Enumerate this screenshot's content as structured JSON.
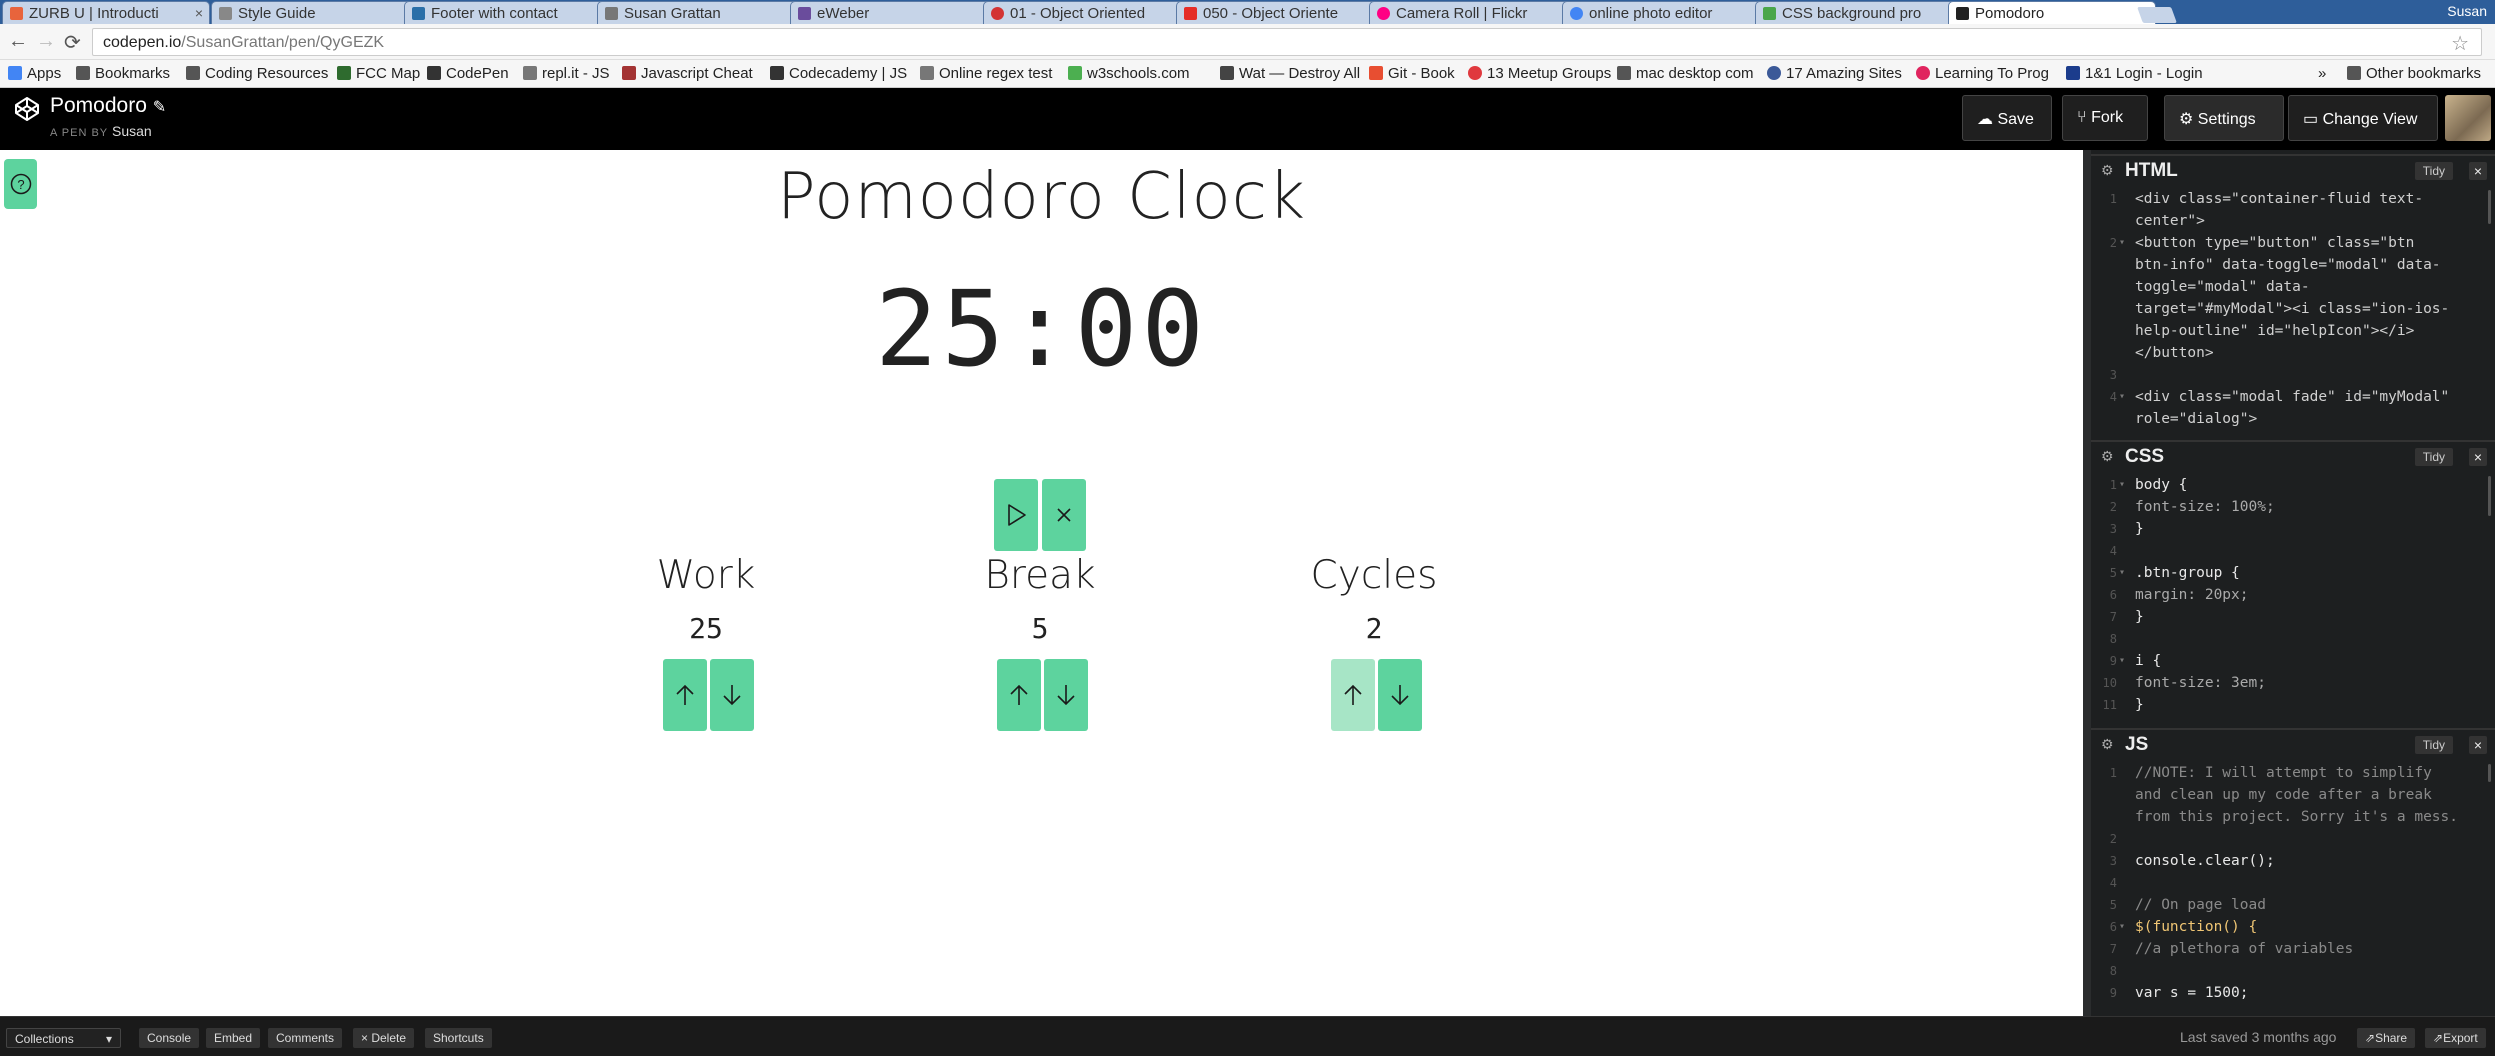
{
  "browser": {
    "tabs": [
      {
        "label": "ZURB U | Introducti",
        "color": "#e8643c"
      },
      {
        "label": "Style Guide",
        "color": "#888888"
      },
      {
        "label": "Footer with contact",
        "color": "#2a6fa8"
      },
      {
        "label": "Susan Grattan",
        "color": "#777777"
      },
      {
        "label": "eWeber",
        "color": "#6a4c9c"
      },
      {
        "label": "01 - Object Oriented",
        "color": "#d33333"
      },
      {
        "label": "050 - Object Oriente",
        "color": "#e52d27"
      },
      {
        "label": "Camera Roll | Flickr",
        "color": "#ff0084"
      },
      {
        "label": "online photo editor",
        "color": "#4285f4"
      },
      {
        "label": "CSS background pro",
        "color": "#4aa64a"
      },
      {
        "label": "Pomodoro",
        "color": "#222222"
      }
    ],
    "tab_close": "×",
    "profile_name": "Susan",
    "address": {
      "host": "codepen.io",
      "path": "/SusanGrattan/pen/QyGEZK"
    },
    "nav": {
      "back": "←",
      "forward": "→",
      "reload": "⟳",
      "star": "☆"
    },
    "bookmarks": [
      {
        "label": "Apps",
        "color": "#4285f4"
      },
      {
        "label": "Bookmarks",
        "color": "#555555"
      },
      {
        "label": "Coding Resources",
        "color": "#555555"
      },
      {
        "label": "FCC Map",
        "color": "#2e6b2e"
      },
      {
        "label": "CodePen",
        "color": "#333333"
      },
      {
        "label": "repl.it - JS",
        "color": "#777777"
      },
      {
        "label": "Javascript Cheat",
        "color": "#a33333"
      },
      {
        "label": "Codecademy | JS",
        "color": "#333333"
      },
      {
        "label": "Online regex test",
        "color": "#777777"
      },
      {
        "label": "w3schools.com",
        "color": "#4caf50"
      },
      {
        "label": "Wat — Destroy All",
        "color": "#444444"
      },
      {
        "label": "Git - Book",
        "color": "#e84e31"
      },
      {
        "label": "13 Meetup Groups",
        "color": "#e0393e"
      },
      {
        "label": "mac desktop com",
        "color": "#555555"
      },
      {
        "label": "17 Amazing Sites",
        "color": "#3b5998"
      },
      {
        "label": "Learning To Prog",
        "color": "#e0245e"
      },
      {
        "label": "1&1 Login - Login",
        "color": "#1b3c8c"
      }
    ],
    "bookmarks_more": "»",
    "other_bookmarks": "Other bookmarks"
  },
  "codepen": {
    "pen_title": "Pomodoro",
    "pen_by_prefix": "A PEN BY",
    "author": "Susan",
    "buttons": {
      "save": "Save",
      "fork": "Fork",
      "settings": "Settings",
      "change_view": "Change View"
    },
    "panels": {
      "html": {
        "name": "HTML",
        "tidy": "Tidy",
        "close": "×",
        "lines": [
          {
            "n": "1",
            "fold": "",
            "text": "<div class=\"container-fluid text-"
          },
          {
            "n": "",
            "fold": "",
            "text": "center\">"
          },
          {
            "n": "2",
            "fold": "▾",
            "text": " <button type=\"button\" class=\"btn"
          },
          {
            "n": "",
            "fold": "",
            "text": " btn-info\" data-toggle=\"modal\" data-"
          },
          {
            "n": "",
            "fold": "",
            "text": " toggle=\"modal\" data-"
          },
          {
            "n": "",
            "fold": "",
            "text": " target=\"#myModal\"><i class=\"ion-ios-"
          },
          {
            "n": "",
            "fold": "",
            "text": " help-outline\" id=\"helpIcon\"></i>"
          },
          {
            "n": "",
            "fold": "",
            "text": " </button>"
          },
          {
            "n": "3",
            "fold": "",
            "text": ""
          },
          {
            "n": "4",
            "fold": "▾",
            "text": " <div class=\"modal fade\" id=\"myModal\""
          },
          {
            "n": "",
            "fold": "",
            "text": " role=\"dialog\">"
          }
        ]
      },
      "css": {
        "name": "CSS",
        "tidy": "Tidy",
        "close": "×",
        "lines": [
          {
            "n": "1",
            "fold": "▾",
            "text": "body {"
          },
          {
            "n": "2",
            "fold": "",
            "text": "  font-size: 100%;"
          },
          {
            "n": "3",
            "fold": "",
            "text": "}"
          },
          {
            "n": "4",
            "fold": "",
            "text": ""
          },
          {
            "n": "5",
            "fold": "▾",
            "text": ".btn-group {"
          },
          {
            "n": "6",
            "fold": "",
            "text": "  margin: 20px;"
          },
          {
            "n": "7",
            "fold": "",
            "text": "}"
          },
          {
            "n": "8",
            "fold": "",
            "text": ""
          },
          {
            "n": "9",
            "fold": "▾",
            "text": "i {"
          },
          {
            "n": "10",
            "fold": "",
            "text": "  font-size: 3em;"
          },
          {
            "n": "11",
            "fold": "",
            "text": "}"
          }
        ]
      },
      "js": {
        "name": "JS",
        "tidy": "Tidy",
        "close": "×",
        "lines": [
          {
            "n": "1",
            "fold": "",
            "text": "//NOTE: I will attempt to simplify"
          },
          {
            "n": "",
            "fold": "",
            "text": "and clean up my code after a break"
          },
          {
            "n": "",
            "fold": "",
            "text": "from this project. Sorry it's a mess."
          },
          {
            "n": "2",
            "fold": "",
            "text": ""
          },
          {
            "n": "3",
            "fold": "",
            "text": "console.clear();"
          },
          {
            "n": "4",
            "fold": "",
            "text": ""
          },
          {
            "n": "5",
            "fold": "",
            "text": "// On page load"
          },
          {
            "n": "6",
            "fold": "▾",
            "text": "$(function() {"
          },
          {
            "n": "7",
            "fold": "",
            "text": "  //a plethora of variables"
          },
          {
            "n": "8",
            "fold": "",
            "text": ""
          },
          {
            "n": "9",
            "fold": "",
            "text": "  var s = 1500;"
          }
        ]
      }
    },
    "footer": {
      "collections": "Collections",
      "console": "Console",
      "embed": "Embed",
      "comments": "Comments",
      "delete": "× Delete",
      "shortcuts": "Shortcuts",
      "last_saved": "Last saved 3 months ago",
      "share": "Share",
      "export": "Export"
    }
  },
  "app": {
    "title": "Pomodoro Clock",
    "time": "25:00",
    "accent": "#5dd39e",
    "work": {
      "label": "Work",
      "value": "25"
    },
    "break": {
      "label": "Break",
      "value": "5"
    },
    "cycles": {
      "label": "Cycles",
      "value": "2"
    }
  }
}
